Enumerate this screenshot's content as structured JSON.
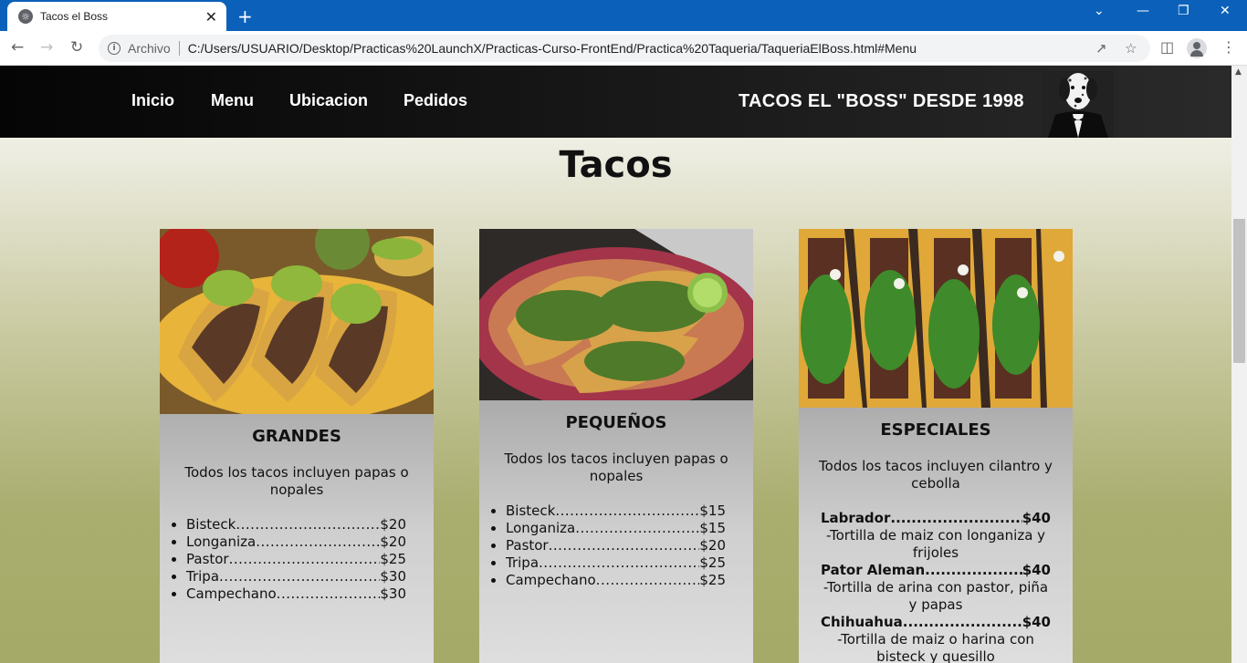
{
  "browser": {
    "tab_title": "Tacos el Boss",
    "address_label": "Archivo",
    "url": "C:/Users/USUARIO/Desktop/Practicas%20LaunchX/Practicas-Curso-FrontEnd/Practica%20Taqueria/TaqueriaElBoss.html#Menu"
  },
  "site": {
    "nav": [
      "Inicio",
      "Menu",
      "Ubicacion",
      "Pedidos"
    ],
    "brand": "TACOS EL \"BOSS\" DESDE 1998",
    "section_title": "Tacos"
  },
  "cards": [
    {
      "title": "GRANDES",
      "note": "Todos los tacos incluyen papas o nopales",
      "items": [
        {
          "name": "Bisteck",
          "price": "$20"
        },
        {
          "name": "Longaniza",
          "price": "$20"
        },
        {
          "name": "Pastor",
          "price": "$25"
        },
        {
          "name": "Tripa",
          "price": "$30"
        },
        {
          "name": "Campechano",
          "price": "$30"
        }
      ]
    },
    {
      "title": "PEQUEÑOS",
      "note": "Todos los tacos incluyen papas o nopales",
      "items": [
        {
          "name": "Bisteck",
          "price": "$15"
        },
        {
          "name": "Longaniza",
          "price": "$15"
        },
        {
          "name": "Pastor",
          "price": "$20"
        },
        {
          "name": "Tripa",
          "price": "$25"
        },
        {
          "name": "Campechano",
          "price": "$25"
        }
      ]
    },
    {
      "title": "ESPECIALES",
      "note": "Todos los tacos incluyen cilantro y cebolla",
      "items": [
        {
          "name": "Labrador",
          "price": "$40",
          "desc": "-Tortilla de maiz con longaniza y frijoles"
        },
        {
          "name": "Pator Aleman",
          "price": "$40",
          "desc": "-Tortilla de arina con pastor, piña y papas"
        },
        {
          "name": "Chihuahua",
          "price": "$40",
          "desc": "-Tortilla de maiz o harina con bisteck y quesillo"
        }
      ]
    }
  ]
}
